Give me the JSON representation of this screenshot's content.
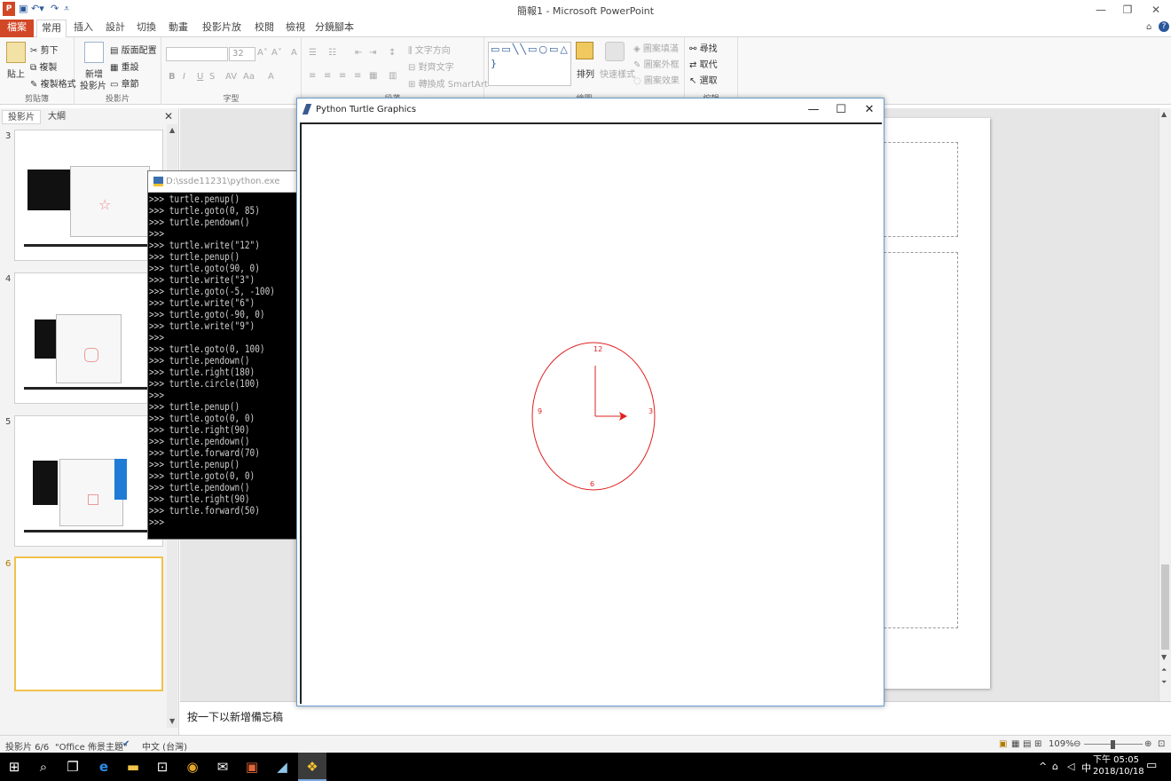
{
  "app": {
    "title": "簡報1 - Microsoft PowerPoint",
    "icon_letter": "P",
    "brand_color": "#d24726"
  },
  "quick_access": [
    "save-icon",
    "undo-icon",
    "redo-icon",
    "customize-icon"
  ],
  "window_controls": {
    "minimize": "—",
    "restore": "❐",
    "close": "✕"
  },
  "ribbon_tabs": [
    {
      "label": "檔案"
    },
    {
      "label": "常用"
    },
    {
      "label": "插入"
    },
    {
      "label": "設計"
    },
    {
      "label": "切換"
    },
    {
      "label": "動畫"
    },
    {
      "label": "投影片放映"
    },
    {
      "label": "校閱"
    },
    {
      "label": "檢視"
    },
    {
      "label": "分鏡腳本"
    }
  ],
  "ribbon": {
    "clipboard": {
      "label": "剪貼簿",
      "paste": "貼上",
      "cut": "剪下",
      "copy": "複製",
      "format_painter": "複製格式"
    },
    "slides": {
      "label": "投影片",
      "new_slide_1": "新增",
      "new_slide_2": "投影片",
      "layout": "版面配置",
      "reset": "重設",
      "section": "章節"
    },
    "font": {
      "label": "字型",
      "font_size": "32",
      "bold": "B",
      "italic": "I",
      "underline": "U",
      "strike": "S"
    },
    "paragraph": {
      "label": "段落",
      "text_direction": "文字方向",
      "align_text": "對齊文字",
      "smartart": "轉換成 SmartArt"
    },
    "drawing": {
      "label": "繪圖",
      "arrange": "排列",
      "quick_styles": "快速樣式",
      "shape_fill": "圖案填滿",
      "shape_outline": "圖案外框",
      "shape_effects": "圖案效果",
      "shapes_glyphs": "▭▭╲╲▭○▭△⌐⌐⇨⇩⌒⤴⌒∧{ }"
    },
    "editing": {
      "label": "編輯",
      "find": "尋找",
      "replace": "取代",
      "select": "選取"
    }
  },
  "left_panel": {
    "tab_slides": "投影片",
    "tab_outline": "大綱",
    "close": "✕",
    "slides": [
      {
        "number": "3"
      },
      {
        "number": "4"
      },
      {
        "number": "5"
      },
      {
        "number": "6"
      }
    ]
  },
  "notes_placeholder": "按一下以新增備忘稿",
  "status": {
    "slide_counter": "投影片 6/6",
    "theme": "\"Office 佈景主題\"",
    "language": "中文 (台灣)",
    "zoom": "109%"
  },
  "console": {
    "title": "D:\\ssde11231\\python.exe",
    "lines": [
      ">>> turtle.penup()",
      ">>> turtle.goto(0, 85)",
      ">>> turtle.pendown()",
      ">>>",
      ">>> turtle.write(\"12\")",
      ">>> turtle.penup()",
      ">>> turtle.goto(90, 0)",
      ">>> turtle.write(\"3\")",
      ">>> turtle.goto(-5, -100)",
      ">>> turtle.write(\"6\")",
      ">>> turtle.goto(-90, 0)",
      ">>> turtle.write(\"9\")",
      ">>>",
      ">>> turtle.goto(0, 100)",
      ">>> turtle.pendown()",
      ">>> turtle.right(180)",
      ">>> turtle.circle(100)",
      ">>>",
      ">>> turtle.penup()",
      ">>> turtle.goto(0, 0)",
      ">>> turtle.right(90)",
      ">>> turtle.pendown()",
      ">>> turtle.forward(70)",
      ">>> turtle.penup()",
      ">>> turtle.goto(0, 0)",
      ">>> turtle.pendown()",
      ">>> turtle.right(90)",
      ">>> turtle.forward(50)",
      ">>>"
    ]
  },
  "turtle_window": {
    "title": "Python Turtle Graphics",
    "minimize": "—",
    "maximize": "☐",
    "close": "✕",
    "clock": {
      "color": "#e02020",
      "labels": {
        "twelve": "12",
        "three": "3",
        "six": "6",
        "nine": "9"
      }
    }
  },
  "taskbar": {
    "apps": [
      "windows-start-icon",
      "search-icon",
      "task-view-icon",
      "edge-icon",
      "file-explorer-icon",
      "store-icon",
      "chrome-icon",
      "mail-icon",
      "powerpoint-icon",
      "notepad-icon",
      "python-icon"
    ],
    "ime": "中",
    "time": "下午 05:05",
    "date": "2018/10/18"
  }
}
